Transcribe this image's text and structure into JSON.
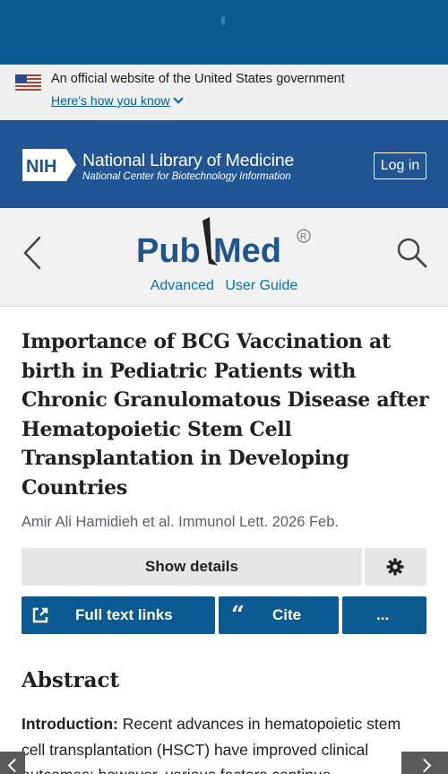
{
  "gov_banner": {
    "text": "An official website of the United States government",
    "link": "Here's how you know"
  },
  "nlm": {
    "logo_text": "NIH",
    "title": "National Library of Medicine",
    "subtitle": "National Center for Biotechnology Information",
    "login": "Log in"
  },
  "pubmed": {
    "logo_part1": "Pub",
    "logo_part2": "Med",
    "links": [
      "Advanced",
      "User Guide"
    ]
  },
  "article": {
    "title": "Importance of BCG Vaccination at birth in Pediatric Patients with Chronic Granulomatous Disease after Hematopoietic Stem Cell Transplantation in Developing Countries",
    "citation": "Amir Ali Hamidieh et al. Immunol Lett. 2026 Feb."
  },
  "actions": {
    "show_details": "Show details",
    "full_text": "Full text links",
    "cite": "Cite",
    "more": "..."
  },
  "abstract": {
    "heading": "Abstract",
    "intro_label": "Introduction:",
    "intro_text": " Recent advances in hematopoietic stem cell transplantation (HSCT) have improved clinical outcomes; however, various factors continue"
  },
  "colors": {
    "status_bar": "#0b5a92",
    "nlm_header": "#205493",
    "pubmed_blue": "#20558a",
    "link_blue": "#0071bc",
    "button_blue": "#0b5a92"
  },
  "icons": [
    "us-flag-icon",
    "chevron-down-icon",
    "nih-logo-icon",
    "back-chevron-icon",
    "search-icon",
    "gear-icon",
    "external-link-icon",
    "quote-icon"
  ]
}
